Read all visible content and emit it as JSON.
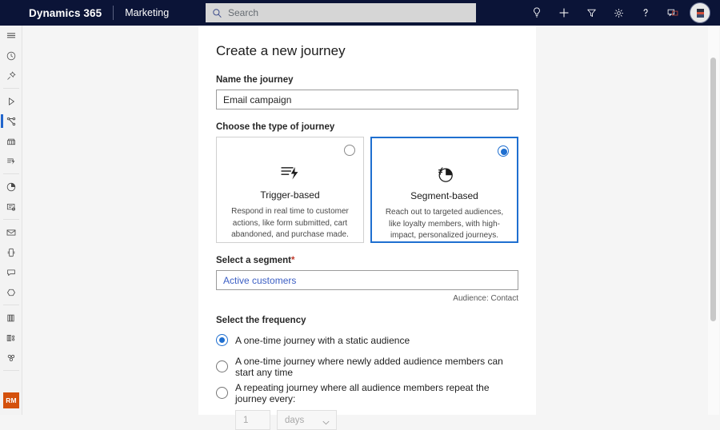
{
  "header": {
    "brand": "Dynamics 365",
    "app_name": "Marketing",
    "search": {
      "placeholder": "Search"
    },
    "icons": [
      {
        "name": "insights-lightbulb-icon",
        "label": "Insights"
      },
      {
        "name": "quick-create-plus-icon",
        "label": "Quick create"
      },
      {
        "name": "filter-icon",
        "label": "Filter"
      },
      {
        "name": "settings-gear-icon",
        "label": "Settings"
      },
      {
        "name": "help-question-icon",
        "label": "Help"
      },
      {
        "name": "feedback-chat-icon",
        "label": "Feedback"
      }
    ],
    "avatar_label": "User profile"
  },
  "rail": {
    "items": [
      {
        "name": "site-map-hamburger-icon",
        "label": "Show site map",
        "selected": false
      },
      {
        "name": "recent-clock-icon",
        "label": "Recent",
        "selected": false
      },
      {
        "name": "pinned-pin-icon",
        "label": "Pinned",
        "selected": false
      },
      {
        "name": "channels-play-icon",
        "label": "Channels",
        "selected": false
      },
      {
        "name": "journeys-flow-icon",
        "label": "Journeys",
        "selected": true
      },
      {
        "name": "segments-grid-icon",
        "label": "Segments",
        "selected": false
      },
      {
        "name": "triggers-bolt-icon",
        "label": "Triggers",
        "selected": false
      },
      {
        "name": "analytics-pie-icon",
        "label": "Analytics",
        "selected": false
      },
      {
        "name": "forms-document-icon",
        "label": "Forms",
        "selected": false
      },
      {
        "name": "emails-envelope-icon",
        "label": "Emails",
        "selected": false
      },
      {
        "name": "text-message-device-icon",
        "label": "Text messages",
        "selected": false
      },
      {
        "name": "push-notification-icon",
        "label": "Push notifications",
        "selected": false
      },
      {
        "name": "custom-channel-icon",
        "label": "Custom channels",
        "selected": false
      },
      {
        "name": "library-books-icon",
        "label": "Library",
        "selected": false
      },
      {
        "name": "assets-icon",
        "label": "Assets",
        "selected": false
      },
      {
        "name": "audience-people-icon",
        "label": "Audience",
        "selected": false
      }
    ],
    "badge": "RM"
  },
  "main": {
    "title": "Create a new journey",
    "name_field": {
      "label": "Name the journey",
      "value": "Email campaign"
    },
    "type_section": {
      "label": "Choose the type of journey",
      "cards": [
        {
          "id": "trigger-based",
          "title": "Trigger-based",
          "description": "Respond in real time to customer actions, like form submitted, cart abandoned, and purchase made.",
          "selected": false
        },
        {
          "id": "segment-based",
          "title": "Segment-based",
          "description": "Reach out to targeted audiences, like loyalty members, with high-impact, personalized journeys.",
          "selected": true
        }
      ]
    },
    "segment_field": {
      "label": "Select a segment",
      "required_mark": "*",
      "value": "Active customers",
      "audience_note": "Audience: Contact"
    },
    "frequency_section": {
      "label": "Select the frequency",
      "options": [
        {
          "id": "one-time-static",
          "label": "A one-time journey with a static audience",
          "checked": true
        },
        {
          "id": "one-time-rolling",
          "label": "A one-time journey where newly added audience members can start any time",
          "checked": false
        },
        {
          "id": "repeating",
          "label": "A repeating journey where all audience members repeat the journey every:",
          "checked": false
        }
      ],
      "repeat_interval": {
        "value": "1",
        "unit": "days"
      }
    }
  },
  "colors": {
    "header_bg": "#0b1437",
    "accent_blue": "#1f6fd0",
    "badge_orange": "#d4510c",
    "link_blue": "#3b5ec4"
  }
}
